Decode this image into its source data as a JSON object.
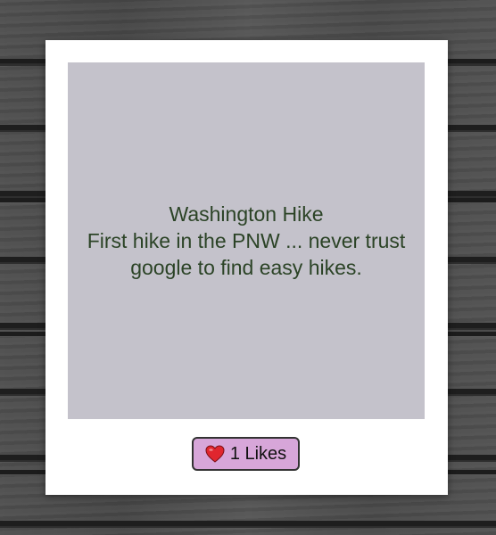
{
  "post": {
    "title": "Washington Hike",
    "description": "First hike in the PNW ... never trust google to find easy hikes.",
    "like_count": "1",
    "like_suffix": "Likes",
    "like_label": "1 Likes",
    "like_icon": "heart-icon"
  },
  "colors": {
    "card": "#ffffff",
    "photo_placeholder": "#c4c2cb",
    "text": "#2b4326",
    "like_button": "#d7a6d9",
    "heart": "#e0262e",
    "background": "#4a4a4a"
  }
}
